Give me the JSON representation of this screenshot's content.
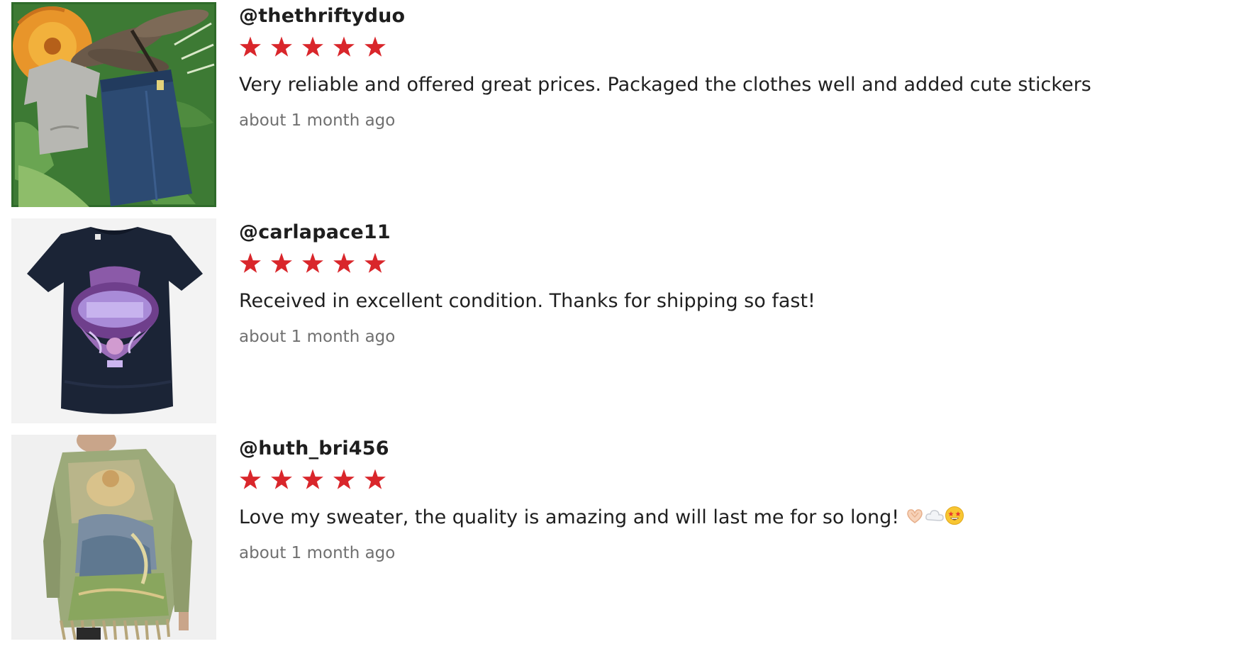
{
  "colors": {
    "star": "#d9262b",
    "username": "#1e1e1e",
    "text": "#1f1f1f",
    "timestamp": "#707070",
    "thumb1_bg": "#2f6b2a",
    "thumb2_bg": "#f3f3f3",
    "thumb3_bg": "#f0f0f0"
  },
  "reviews": [
    {
      "username": "@thethriftyduo",
      "rating": 5,
      "text": "Very reliable and offered great prices. Packaged the clothes well and added cute stickers",
      "timestamp": "about 1 month ago",
      "thumbnail_icon": "clothing-collage-thumbnail"
    },
    {
      "username": "@carlapace11",
      "rating": 5,
      "text": "Received in excellent condition. Thanks for shipping so fast!",
      "timestamp": "about 1 month ago",
      "thumbnail_icon": "navy-tshirt-thumbnail"
    },
    {
      "username": "@huth_bri456",
      "rating": 5,
      "text": "Love my sweater, the quality is amazing and will last me for so long!",
      "timestamp": "about 1 month ago",
      "thumbnail_icon": "tapestry-sweater-thumbnail",
      "emojis": [
        "heart-hands-emoji",
        "cloud-emoji",
        "star-struck-emoji"
      ]
    }
  ]
}
